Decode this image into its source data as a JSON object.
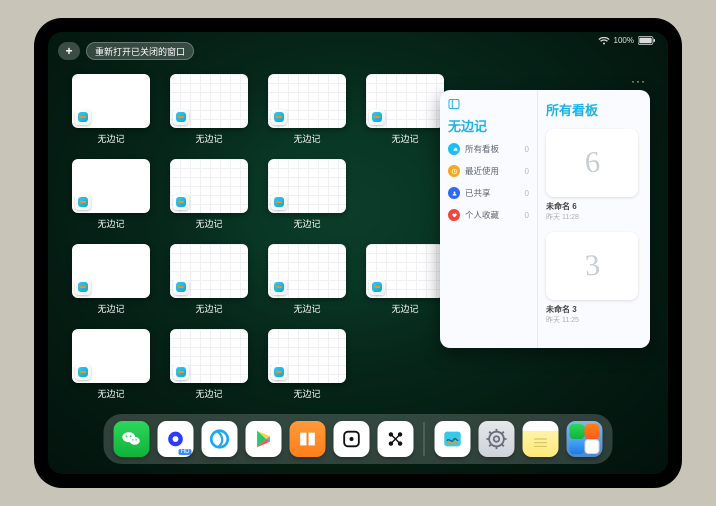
{
  "status": {
    "battery": "100%"
  },
  "toolbar": {
    "plus": "+",
    "reopen_label": "重新打开已关闭的窗口"
  },
  "app_name": "无边记",
  "tiles": [
    [
      {
        "label": "无边记",
        "variant": "blank"
      },
      {
        "label": "无边记",
        "variant": "grid"
      },
      {
        "label": "无边记",
        "variant": "grid"
      },
      {
        "label": "无边记",
        "variant": "grid"
      }
    ],
    [
      {
        "label": "无边记",
        "variant": "blank"
      },
      {
        "label": "无边记",
        "variant": "grid"
      },
      {
        "label": "无边记",
        "variant": "grid"
      }
    ],
    [
      {
        "label": "无边记",
        "variant": "blank"
      },
      {
        "label": "无边记",
        "variant": "grid"
      },
      {
        "label": "无边记",
        "variant": "grid"
      },
      {
        "label": "无边记",
        "variant": "grid"
      }
    ],
    [
      {
        "label": "无边记",
        "variant": "blank"
      },
      {
        "label": "无边记",
        "variant": "grid"
      },
      {
        "label": "无边记",
        "variant": "grid"
      }
    ]
  ],
  "panel": {
    "more": "···",
    "left_title": "无边记",
    "items": [
      {
        "icon": "cloud",
        "label": "所有看板",
        "count": 0
      },
      {
        "icon": "clock",
        "label": "最近使用",
        "count": 0
      },
      {
        "icon": "people",
        "label": "已共享",
        "count": 0
      },
      {
        "icon": "heart",
        "label": "个人收藏",
        "count": 0
      }
    ],
    "right_title": "所有看板",
    "boards": [
      {
        "scribble": "6",
        "name": "未命名 6",
        "date": "昨天 11:28"
      },
      {
        "scribble": "3",
        "name": "未命名 3",
        "date": "昨天 11:25"
      }
    ]
  },
  "dock": {
    "apps_left": [
      {
        "name": "wechat-app",
        "kind": "wechat"
      },
      {
        "name": "quark-app",
        "kind": "quark"
      },
      {
        "name": "qq-browser-app",
        "kind": "qqb"
      },
      {
        "name": "play-app",
        "kind": "play"
      },
      {
        "name": "books-app",
        "kind": "books"
      },
      {
        "name": "dice-app",
        "kind": "dice"
      },
      {
        "name": "connect-app",
        "kind": "connect"
      }
    ],
    "apps_right": [
      {
        "name": "freeform-app",
        "kind": "freeform"
      },
      {
        "name": "settings-app",
        "kind": "settings"
      },
      {
        "name": "notes-app",
        "kind": "notes"
      },
      {
        "name": "app-library",
        "kind": "folder"
      }
    ]
  }
}
